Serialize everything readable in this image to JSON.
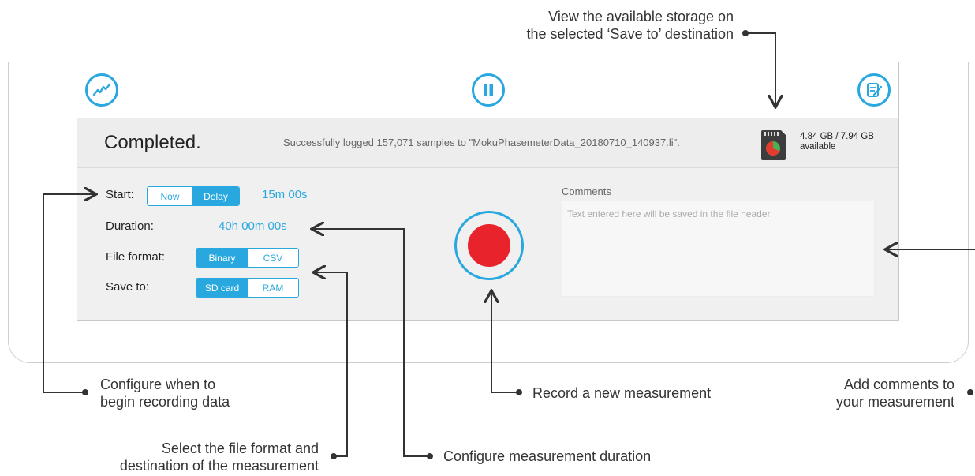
{
  "status": {
    "title": "Completed.",
    "message": "Successfully logged 157,071 samples to \"MokuPhasemeterData_20180710_140937.li\".",
    "storage_line1": "4.84 GB / 7.94 GB",
    "storage_line2": "available"
  },
  "toolbar": {
    "left_icon": "trend-line-icon",
    "center_icon": "pause-icon",
    "right_icon": "edit-notes-icon"
  },
  "settings": {
    "start_label": "Start:",
    "start_options": [
      "Now",
      "Delay"
    ],
    "start_selected": "Delay",
    "delay_value": "15m 00s",
    "duration_label": "Duration:",
    "duration_value": "40h 00m 00s",
    "file_format_label": "File format:",
    "file_format_options": [
      "Binary",
      "CSV"
    ],
    "file_format_selected": "Binary",
    "save_to_label": "Save to:",
    "save_to_options": [
      "SD card",
      "RAM"
    ],
    "save_to_selected": "SD card"
  },
  "comments": {
    "label": "Comments",
    "placeholder": "Text entered here will be saved in the file header."
  },
  "annotations": {
    "storage_line1": "View the available storage on",
    "storage_line2": "the selected ‘Save to’ destination",
    "start_line1": "Configure when to",
    "start_line2": "begin recording data",
    "record": "Record a new measurement",
    "comments_line1": "Add comments to",
    "comments_line2": "your measurement",
    "format_line1": "Select the file format and",
    "format_line2": "destination of the measurement",
    "duration": "Configure measurement duration"
  },
  "colors": {
    "accent": "#29a8e0",
    "record": "#e8232b"
  }
}
